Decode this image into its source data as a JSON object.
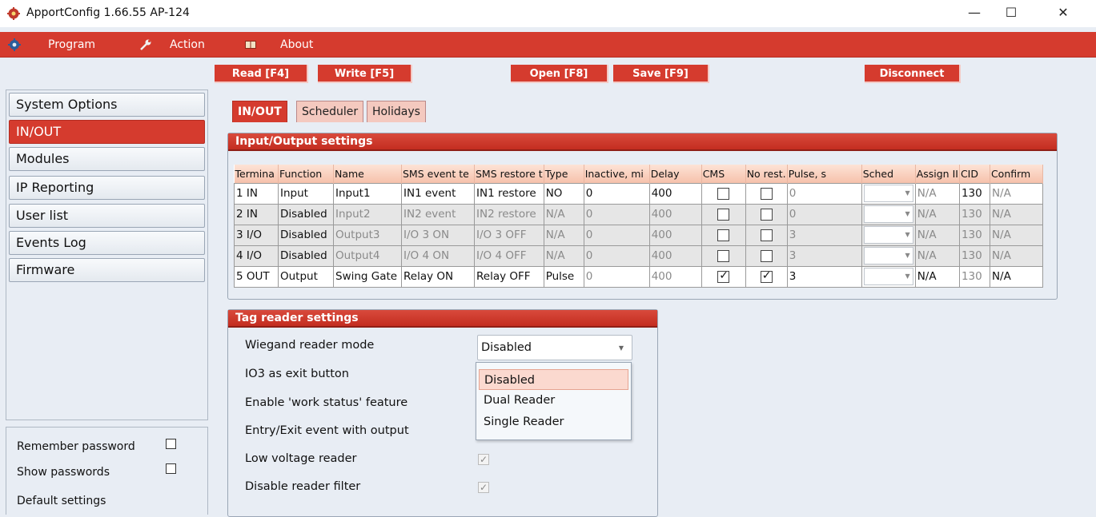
{
  "window": {
    "title": "ApportConfig 1.66.55   AP-124",
    "minimize": "—",
    "maximize": "☐",
    "close": "✕"
  },
  "menu": {
    "program": "Program",
    "action": "Action",
    "about": "About"
  },
  "toolbar": {
    "read": "Read [F4]",
    "write": "Write [F5]",
    "open": "Open [F8]",
    "save": "Save [F9]",
    "disconnect": "Disconnect"
  },
  "sidebar": {
    "items": [
      "System Options",
      "IN/OUT",
      "Modules",
      "IP Reporting",
      "User list",
      "Events Log",
      "Firmware"
    ],
    "active": "IN/OUT",
    "remember_password": "Remember password",
    "show_passwords": "Show passwords",
    "default_settings": "Default settings"
  },
  "tabs": [
    "IN/OUT",
    "Scheduler",
    "Holidays"
  ],
  "io_settings": {
    "title": "Input/Output settings",
    "columns": [
      "Termina",
      "Function",
      "Name",
      "SMS event te",
      "SMS restore t",
      "Type",
      "Inactive, mi",
      "Delay",
      "CMS",
      "No rest.",
      "Pulse, s",
      "Sched",
      "Assign II",
      "CID",
      "Confirm"
    ],
    "rows": [
      {
        "terminal": "1 IN",
        "function": "Input",
        "name": "Input1",
        "sms_event": "IN1 event",
        "sms_restore": "IN1 restore",
        "type": "NO",
        "inactive": "0",
        "delay": "400",
        "cms": false,
        "no_restore": false,
        "pulse": "0",
        "sched": "",
        "assign": "N/A",
        "cid": "130",
        "confirm": "N/A"
      },
      {
        "terminal": "2 IN",
        "function": "Disabled",
        "name": "Input2",
        "sms_event": "IN2 event",
        "sms_restore": "IN2 restore",
        "type": "N/A",
        "inactive": "0",
        "delay": "400",
        "cms": false,
        "no_restore": false,
        "pulse": "0",
        "sched": "",
        "assign": "N/A",
        "cid": "130",
        "confirm": "N/A"
      },
      {
        "terminal": "3 I/O",
        "function": "Disabled",
        "name": "Output3",
        "sms_event": "I/O 3 ON",
        "sms_restore": "I/O 3 OFF",
        "type": "N/A",
        "inactive": "0",
        "delay": "400",
        "cms": false,
        "no_restore": false,
        "pulse": "3",
        "sched": "",
        "assign": "N/A",
        "cid": "130",
        "confirm": "N/A"
      },
      {
        "terminal": "4 I/O",
        "function": "Disabled",
        "name": "Output4",
        "sms_event": "I/O 4 ON",
        "sms_restore": "I/O 4 OFF",
        "type": "N/A",
        "inactive": "0",
        "delay": "400",
        "cms": false,
        "no_restore": false,
        "pulse": "3",
        "sched": "",
        "assign": "N/A",
        "cid": "130",
        "confirm": "N/A"
      },
      {
        "terminal": "5 OUT",
        "function": "Output",
        "name": "Swing Gate",
        "sms_event": "Relay ON",
        "sms_restore": "Relay OFF",
        "type": "Pulse",
        "inactive": "0",
        "delay": "400",
        "cms": true,
        "no_restore": true,
        "pulse": "3",
        "sched": "",
        "assign": "N/A",
        "cid": "130",
        "confirm": "N/A"
      }
    ]
  },
  "tag_reader": {
    "title": "Tag reader settings",
    "wiegand_label": "Wiegand reader mode",
    "wiegand_value": "Disabled",
    "wiegand_options": [
      "Disabled",
      "Dual Reader",
      "Single Reader"
    ],
    "io3_exit": "IO3 as exit button",
    "work_status": "Enable 'work status' feature",
    "entry_exit": "Entry/Exit event with output",
    "low_voltage": "Low voltage reader",
    "disable_filter": "Disable reader filter"
  },
  "colors": {
    "accent": "#d53b2e",
    "background": "#e8edf4"
  }
}
